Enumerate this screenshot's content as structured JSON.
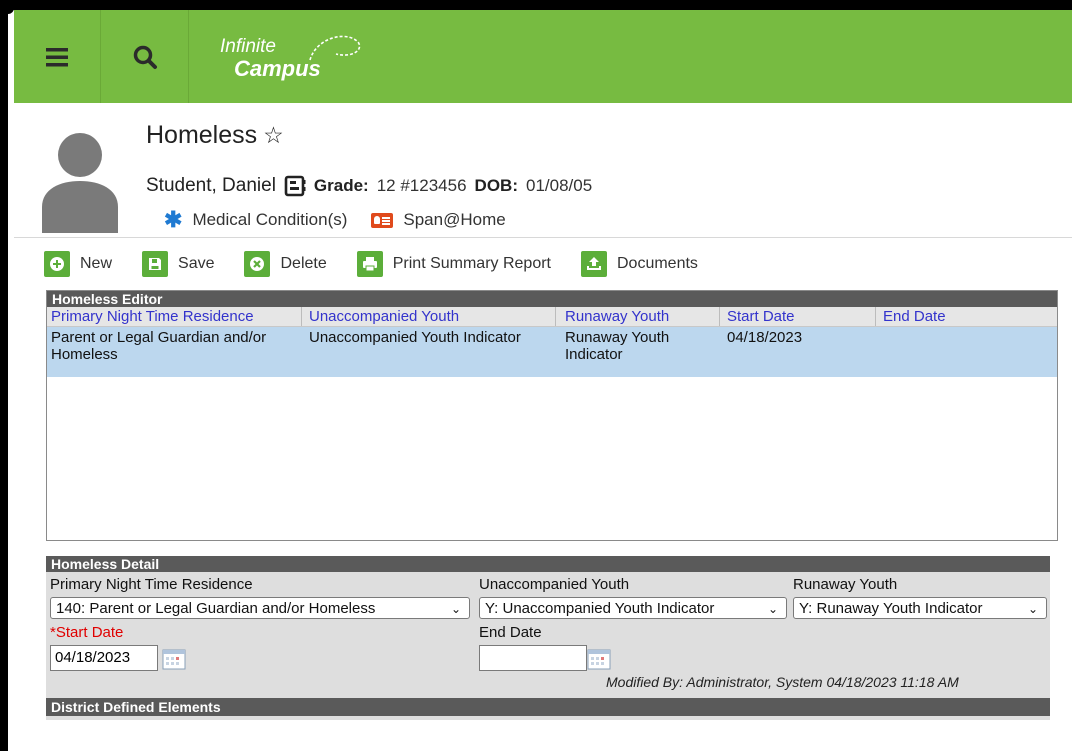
{
  "brand": {
    "line1": "Infinite",
    "line2": "Campus"
  },
  "page": {
    "title": "Homeless"
  },
  "student": {
    "name": "Student, Daniel",
    "grade_label": "Grade:",
    "grade_value": "12 #123456",
    "dob_label": "DOB:",
    "dob_value": "01/08/05"
  },
  "alerts": {
    "medical": "Medical Condition(s)",
    "language": "Span@Home"
  },
  "toolbar": {
    "new": "New",
    "save": "Save",
    "delete": "Delete",
    "print": "Print Summary Report",
    "documents": "Documents"
  },
  "editor": {
    "title": "Homeless Editor",
    "columns": [
      "Primary Night Time Residence",
      "Unaccompanied Youth",
      "Runaway Youth",
      "Start Date",
      "End Date"
    ],
    "rows": [
      {
        "residence": "Parent or Legal Guardian and/or Homeless",
        "unaccompanied": "Unaccompanied Youth Indicator",
        "runaway": "Runaway Youth Indicator",
        "start": "04/18/2023",
        "end": ""
      }
    ]
  },
  "detail": {
    "title": "Homeless Detail",
    "residence_label": "Primary Night Time Residence",
    "residence_value": "140: Parent or Legal Guardian and/or Homeless",
    "unaccompanied_label": "Unaccompanied Youth",
    "unaccompanied_value": "Y: Unaccompanied Youth Indicator",
    "runaway_label": "Runaway Youth",
    "runaway_value": "Y: Runaway Youth Indicator",
    "start_required_mark": "*",
    "start_label": "Start Date",
    "start_value": "04/18/2023",
    "end_label": "End Date",
    "end_value": "",
    "modified": "Modified By: Administrator, System 04/18/2023 11:18 AM"
  },
  "district": {
    "title": "District Defined Elements"
  },
  "colors": {
    "brand_green": "#77bb41",
    "tool_green": "#5cae3a",
    "selected_row": "#bcd7ee",
    "panel_header": "#5a5a5a",
    "link_blue": "#3333cc"
  }
}
